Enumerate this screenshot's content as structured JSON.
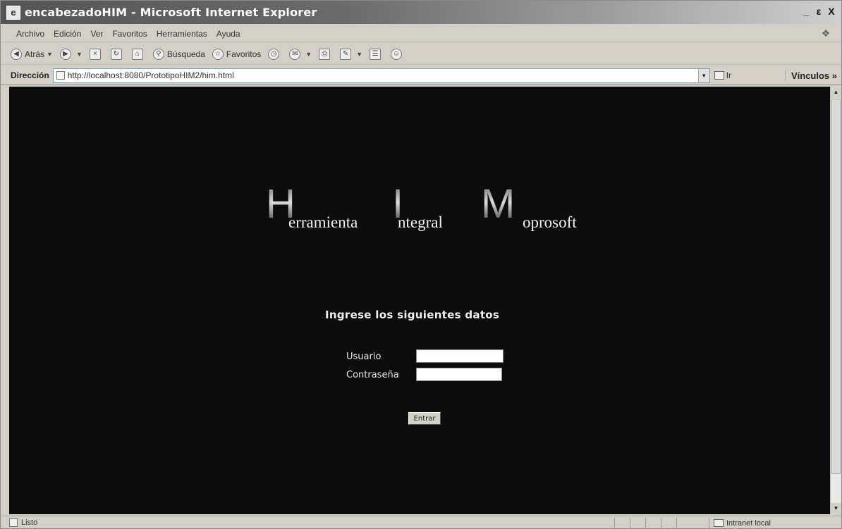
{
  "window": {
    "title": "encabezadoHIM - Microsoft Internet Explorer",
    "controls": [
      "_",
      "ε",
      "X"
    ]
  },
  "menu": [
    "Archivo",
    "Edición",
    "Ver",
    "Favoritos",
    "Herramientas",
    "Ayuda"
  ],
  "toolbar": {
    "back_label": "Atrás",
    "search_label": "Búsqueda",
    "favorites_label": "Favoritos"
  },
  "address": {
    "label": "Dirección",
    "url": "http://localhost:8080/PrototipoHIM2/him.html",
    "go_label": "Ir",
    "links_label": "Vínculos »"
  },
  "page": {
    "logo": {
      "big_h": "H",
      "big_i": "I",
      "big_m": "M",
      "word_1": "erramienta",
      "word_2": "ntegral",
      "word_3": "oprosoft"
    },
    "heading": "Ingrese los siguientes datos",
    "user_label": "Usuario",
    "password_label": "Contraseña",
    "user_value": "",
    "password_value": "",
    "submit_label": "Entrar"
  },
  "status": {
    "text": "Listo",
    "zone": "Intranet local"
  }
}
